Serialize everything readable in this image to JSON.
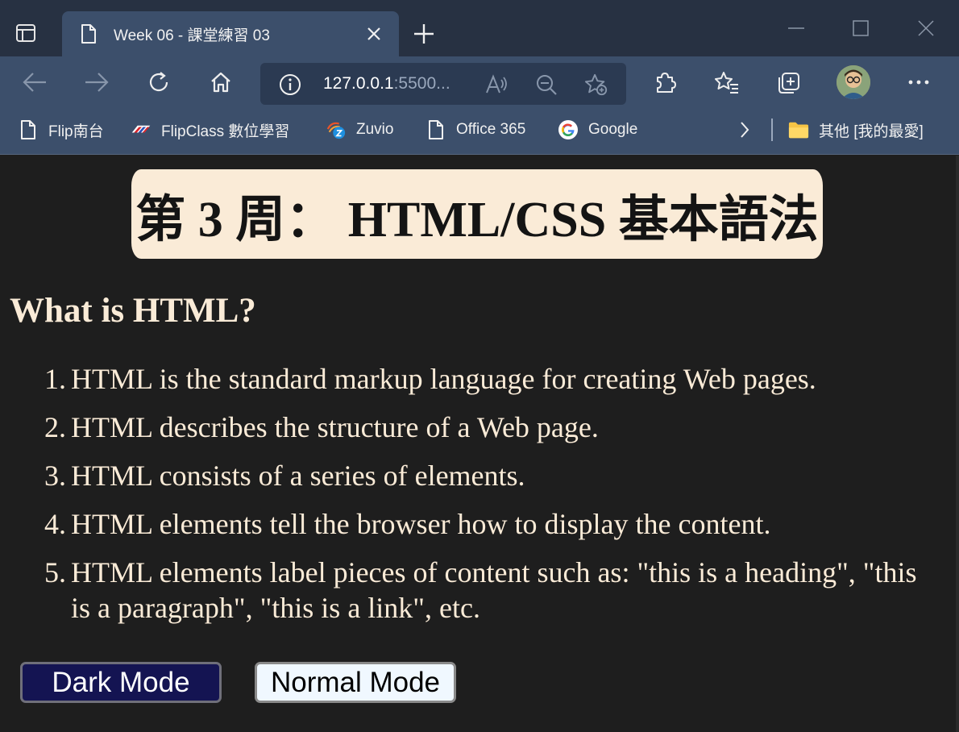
{
  "tab": {
    "title": "Week 06 - 課堂練習 03"
  },
  "address": {
    "url_host": "127.0.0.1",
    "url_rest": ":5500..."
  },
  "bookmarks": [
    {
      "label": "Flip南台",
      "icon": "page-icon"
    },
    {
      "label": "FlipClass 數位學習",
      "icon": "flipclass-logo-icon"
    },
    {
      "label": "Zuvio",
      "icon": "zuvio-logo-icon"
    },
    {
      "label": "Office 365",
      "icon": "page-icon"
    },
    {
      "label": "Google",
      "icon": "google-logo-icon"
    }
  ],
  "other_favorites": {
    "label": "其他 [我的最愛]",
    "icon": "folder-icon"
  },
  "page": {
    "banner_title": "第 3 周： HTML/CSS 基本語法",
    "heading": "What is HTML?",
    "items": [
      {
        "num": "1.",
        "text": "HTML is the standard markup language for creating Web pages."
      },
      {
        "num": "2.",
        "text": "HTML describes the structure of a Web page."
      },
      {
        "num": "3.",
        "text": "HTML consists of a series of elements."
      },
      {
        "num": "4.",
        "text": "HTML elements tell the browser how to display the content."
      },
      {
        "num": "5.",
        "text": "HTML elements label pieces of content such as: \"this is a heading\", \"this is a paragraph\", \"this is a link\", etc."
      }
    ],
    "dark_button": "Dark Mode",
    "normal_button": "Normal Mode"
  },
  "colors": {
    "tabstrip": "#273142",
    "toolbar": "#3c4f6b",
    "page_bg": "#1e1e1e",
    "text": "#faebd7",
    "banner_bg": "#faebd7",
    "dark_button_bg": "#141452",
    "normal_button_bg": "#f0f8ff"
  }
}
